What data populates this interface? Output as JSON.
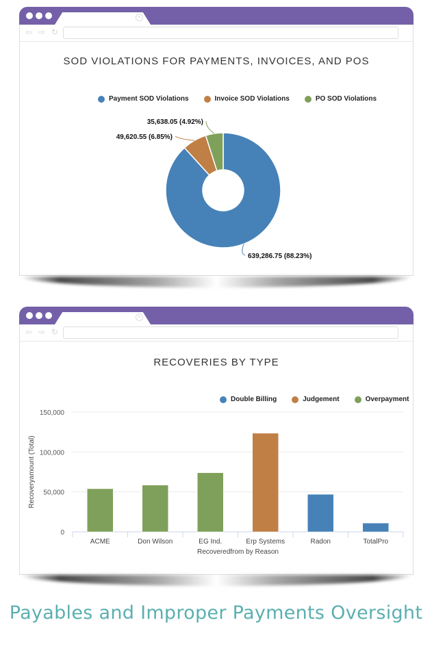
{
  "browser": {
    "nav_back_icon": "back-arrow-icon",
    "nav_forward_icon": "forward-arrow-icon",
    "nav_reload_icon": "reload-icon",
    "tab_close_icon": "close-icon"
  },
  "colors": {
    "chrome_purple": "#7460a8",
    "blue": "#4682b8",
    "orange": "#c07f45",
    "green": "#7fa05a",
    "footer_teal": "#5bafb0"
  },
  "footer": {
    "text": "Payables and Improper Payments Oversight"
  },
  "chart_data": [
    {
      "type": "pie",
      "donut": true,
      "title": "SOD VIOLATIONS FOR PAYMENTS, INVOICES, AND POS",
      "legend_position": "top-right",
      "categories": [
        "Payment SOD Violations",
        "Invoice SOD Violations",
        "PO SOD Violations"
      ],
      "values": [
        639286.75,
        49620.55,
        35638.05
      ],
      "percents": [
        88.23,
        6.85,
        4.92
      ],
      "labels": [
        "639,286.75 (88.23%)",
        "49,620.55 (6.85%)",
        "35,638.05 (4.92%)"
      ],
      "colors": [
        "#4682b8",
        "#c07f45",
        "#7fa05a"
      ]
    },
    {
      "type": "bar",
      "title": "RECOVERIES BY TYPE",
      "xlabel": "Recoveredfrom by Reason",
      "ylabel": "Recoveryamount (Total)",
      "ylim": [
        0,
        150000
      ],
      "yticks": [
        0,
        50000,
        100000,
        150000
      ],
      "ytick_labels": [
        "0",
        "50,000",
        "100,000",
        "150,000"
      ],
      "grid": true,
      "legend_position": "top-right",
      "legend": [
        {
          "name": "Double Billing",
          "color": "#4682b8"
        },
        {
          "name": "Judgement",
          "color": "#c07f45"
        },
        {
          "name": "Overpayment",
          "color": "#7fa05a"
        }
      ],
      "categories": [
        "ACME",
        "Don Wilson",
        "EG Ind.",
        "Erp Systems",
        "Radon",
        "TotalPro"
      ],
      "values": [
        54000,
        58500,
        74000,
        123500,
        47000,
        11000
      ],
      "series_of_bar": [
        "Overpayment",
        "Overpayment",
        "Overpayment",
        "Judgement",
        "Double Billing",
        "Double Billing"
      ]
    }
  ]
}
